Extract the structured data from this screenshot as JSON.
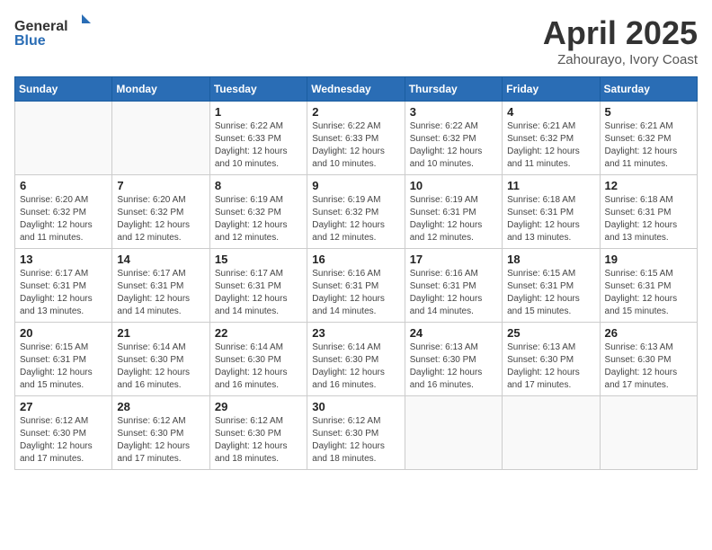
{
  "header": {
    "logo_general": "General",
    "logo_blue": "Blue",
    "title": "April 2025",
    "location": "Zahourayo, Ivory Coast"
  },
  "days_of_week": [
    "Sunday",
    "Monday",
    "Tuesday",
    "Wednesday",
    "Thursday",
    "Friday",
    "Saturday"
  ],
  "weeks": [
    [
      {
        "day": "",
        "info": ""
      },
      {
        "day": "",
        "info": ""
      },
      {
        "day": "1",
        "info": "Sunrise: 6:22 AM\nSunset: 6:33 PM\nDaylight: 12 hours and 10 minutes."
      },
      {
        "day": "2",
        "info": "Sunrise: 6:22 AM\nSunset: 6:33 PM\nDaylight: 12 hours and 10 minutes."
      },
      {
        "day": "3",
        "info": "Sunrise: 6:22 AM\nSunset: 6:32 PM\nDaylight: 12 hours and 10 minutes."
      },
      {
        "day": "4",
        "info": "Sunrise: 6:21 AM\nSunset: 6:32 PM\nDaylight: 12 hours and 11 minutes."
      },
      {
        "day": "5",
        "info": "Sunrise: 6:21 AM\nSunset: 6:32 PM\nDaylight: 12 hours and 11 minutes."
      }
    ],
    [
      {
        "day": "6",
        "info": "Sunrise: 6:20 AM\nSunset: 6:32 PM\nDaylight: 12 hours and 11 minutes."
      },
      {
        "day": "7",
        "info": "Sunrise: 6:20 AM\nSunset: 6:32 PM\nDaylight: 12 hours and 12 minutes."
      },
      {
        "day": "8",
        "info": "Sunrise: 6:19 AM\nSunset: 6:32 PM\nDaylight: 12 hours and 12 minutes."
      },
      {
        "day": "9",
        "info": "Sunrise: 6:19 AM\nSunset: 6:32 PM\nDaylight: 12 hours and 12 minutes."
      },
      {
        "day": "10",
        "info": "Sunrise: 6:19 AM\nSunset: 6:31 PM\nDaylight: 12 hours and 12 minutes."
      },
      {
        "day": "11",
        "info": "Sunrise: 6:18 AM\nSunset: 6:31 PM\nDaylight: 12 hours and 13 minutes."
      },
      {
        "day": "12",
        "info": "Sunrise: 6:18 AM\nSunset: 6:31 PM\nDaylight: 12 hours and 13 minutes."
      }
    ],
    [
      {
        "day": "13",
        "info": "Sunrise: 6:17 AM\nSunset: 6:31 PM\nDaylight: 12 hours and 13 minutes."
      },
      {
        "day": "14",
        "info": "Sunrise: 6:17 AM\nSunset: 6:31 PM\nDaylight: 12 hours and 14 minutes."
      },
      {
        "day": "15",
        "info": "Sunrise: 6:17 AM\nSunset: 6:31 PM\nDaylight: 12 hours and 14 minutes."
      },
      {
        "day": "16",
        "info": "Sunrise: 6:16 AM\nSunset: 6:31 PM\nDaylight: 12 hours and 14 minutes."
      },
      {
        "day": "17",
        "info": "Sunrise: 6:16 AM\nSunset: 6:31 PM\nDaylight: 12 hours and 14 minutes."
      },
      {
        "day": "18",
        "info": "Sunrise: 6:15 AM\nSunset: 6:31 PM\nDaylight: 12 hours and 15 minutes."
      },
      {
        "day": "19",
        "info": "Sunrise: 6:15 AM\nSunset: 6:31 PM\nDaylight: 12 hours and 15 minutes."
      }
    ],
    [
      {
        "day": "20",
        "info": "Sunrise: 6:15 AM\nSunset: 6:31 PM\nDaylight: 12 hours and 15 minutes."
      },
      {
        "day": "21",
        "info": "Sunrise: 6:14 AM\nSunset: 6:30 PM\nDaylight: 12 hours and 16 minutes."
      },
      {
        "day": "22",
        "info": "Sunrise: 6:14 AM\nSunset: 6:30 PM\nDaylight: 12 hours and 16 minutes."
      },
      {
        "day": "23",
        "info": "Sunrise: 6:14 AM\nSunset: 6:30 PM\nDaylight: 12 hours and 16 minutes."
      },
      {
        "day": "24",
        "info": "Sunrise: 6:13 AM\nSunset: 6:30 PM\nDaylight: 12 hours and 16 minutes."
      },
      {
        "day": "25",
        "info": "Sunrise: 6:13 AM\nSunset: 6:30 PM\nDaylight: 12 hours and 17 minutes."
      },
      {
        "day": "26",
        "info": "Sunrise: 6:13 AM\nSunset: 6:30 PM\nDaylight: 12 hours and 17 minutes."
      }
    ],
    [
      {
        "day": "27",
        "info": "Sunrise: 6:12 AM\nSunset: 6:30 PM\nDaylight: 12 hours and 17 minutes."
      },
      {
        "day": "28",
        "info": "Sunrise: 6:12 AM\nSunset: 6:30 PM\nDaylight: 12 hours and 17 minutes."
      },
      {
        "day": "29",
        "info": "Sunrise: 6:12 AM\nSunset: 6:30 PM\nDaylight: 12 hours and 18 minutes."
      },
      {
        "day": "30",
        "info": "Sunrise: 6:12 AM\nSunset: 6:30 PM\nDaylight: 12 hours and 18 minutes."
      },
      {
        "day": "",
        "info": ""
      },
      {
        "day": "",
        "info": ""
      },
      {
        "day": "",
        "info": ""
      }
    ]
  ]
}
